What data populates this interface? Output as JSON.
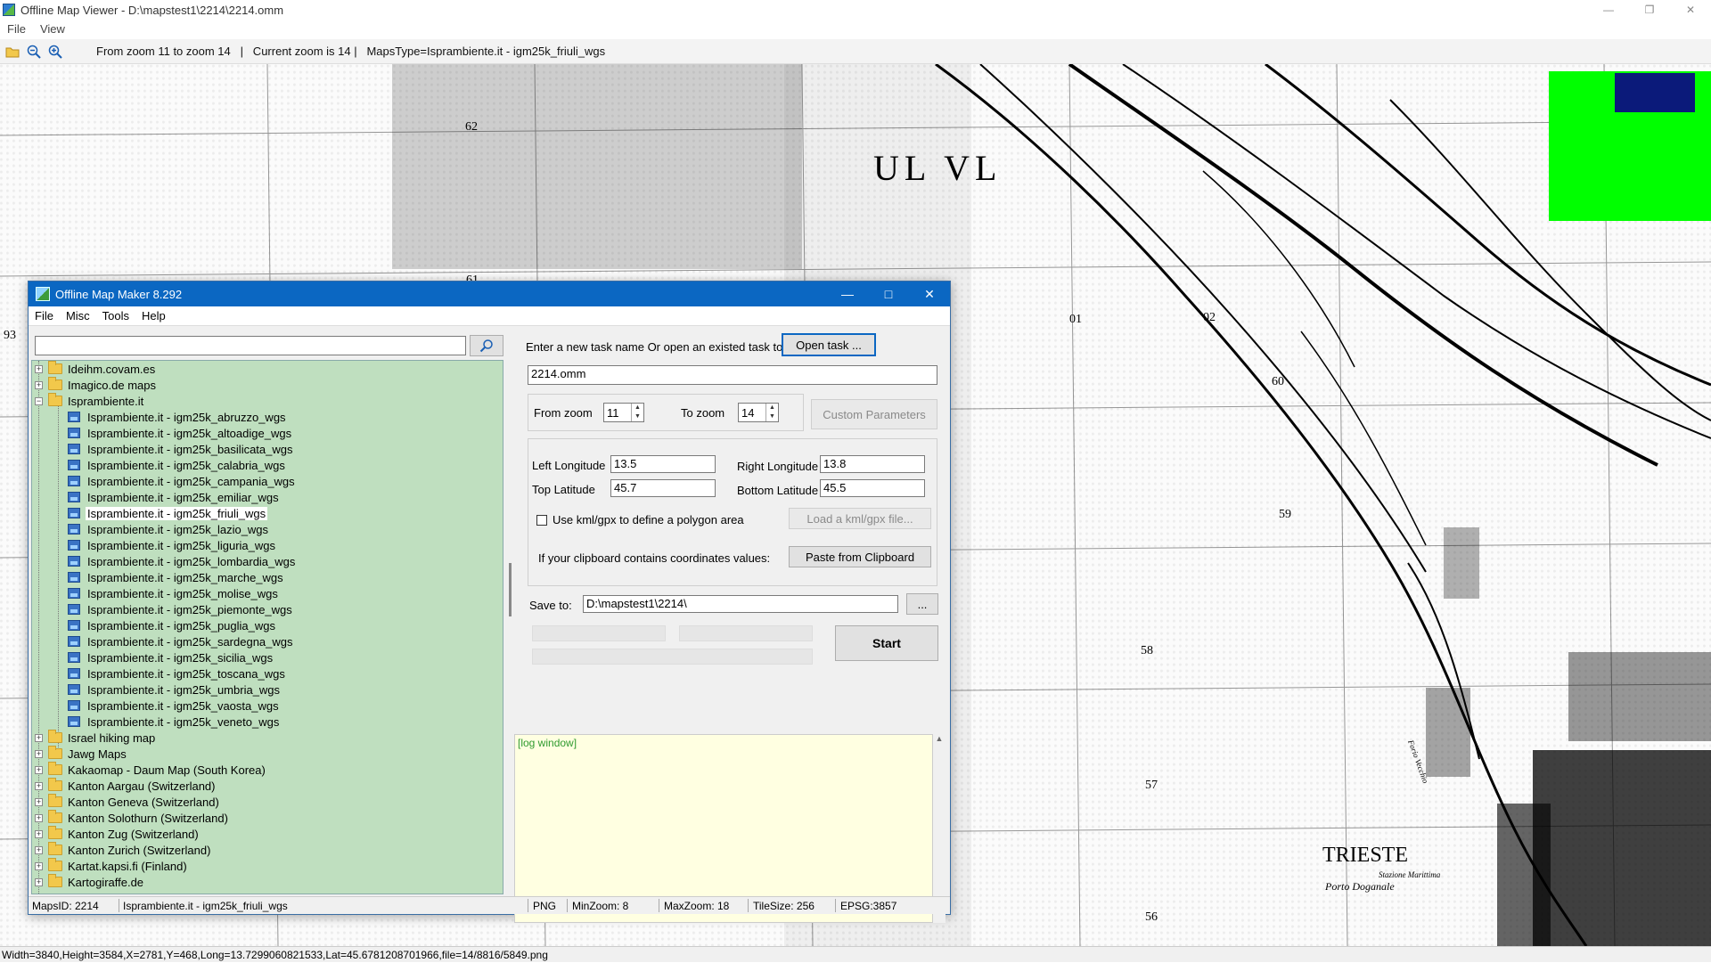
{
  "viewer": {
    "title": "Offline Map Viewer - D:\\mapstest1\\2214\\2214.omm",
    "menu": [
      "File",
      "View"
    ],
    "toolbar_text": "From zoom 11 to zoom 14   |   Current zoom is 14 |   MapsType=Isprambiente.it - igm25k_friuli_wgs",
    "status": "Width=3840,Height=3584,X=2781,Y=468,Long=13.7299060821533,Lat=45.6781208701966,file=14/8816/5849.png"
  },
  "map_labels": [
    "62",
    "UL VL",
    "61",
    "93",
    "01",
    "02",
    "60",
    "59",
    "58",
    "57",
    "56",
    "TRIESTE",
    "Porto Doganale",
    "Stazione Marittima",
    "Forio Vecchio"
  ],
  "dialog": {
    "title": "Offline Map Maker 8.292",
    "menu": [
      "File",
      "Misc",
      "Tools",
      "Help"
    ],
    "search_placeholder": "",
    "tree": {
      "top_folders": [
        "Ideihm.covam.es",
        "Imagico.de maps"
      ],
      "open_folder": "Isprambiente.it",
      "maps": [
        "Isprambiente.it - igm25k_abruzzo_wgs",
        "Isprambiente.it - igm25k_altoadige_wgs",
        "Isprambiente.it - igm25k_basilicata_wgs",
        "Isprambiente.it - igm25k_calabria_wgs",
        "Isprambiente.it - igm25k_campania_wgs",
        "Isprambiente.it - igm25k_emiliar_wgs",
        "Isprambiente.it - igm25k_friuli_wgs",
        "Isprambiente.it - igm25k_lazio_wgs",
        "Isprambiente.it - igm25k_liguria_wgs",
        "Isprambiente.it - igm25k_lombardia_wgs",
        "Isprambiente.it - igm25k_marche_wgs",
        "Isprambiente.it - igm25k_molise_wgs",
        "Isprambiente.it - igm25k_piemonte_wgs",
        "Isprambiente.it - igm25k_puglia_wgs",
        "Isprambiente.it - igm25k_sardegna_wgs",
        "Isprambiente.it - igm25k_sicilia_wgs",
        "Isprambiente.it - igm25k_toscana_wgs",
        "Isprambiente.it - igm25k_umbria_wgs",
        "Isprambiente.it - igm25k_vaosta_wgs",
        "Isprambiente.it - igm25k_veneto_wgs"
      ],
      "selected_map": "Isprambiente.it - igm25k_friuli_wgs",
      "bottom_folders": [
        "Israel hiking map",
        "Jawg Maps",
        "Kakaomap - Daum Map (South Korea)",
        "Kanton Aargau (Switzerland)",
        "Kanton Geneva (Switzerland)",
        "Kanton Solothurn (Switzerland)",
        "Kanton Zug (Switzerland)",
        "Kanton Zurich (Switzerland)",
        "Kartat.kapsi.fi (Finland)",
        "Kartogiraffe.de"
      ]
    },
    "task_prompt": "Enter a new task name Or open an existed task to continue:",
    "open_task_label": "Open task ...",
    "task_name": "2214.omm",
    "from_zoom_label": "From zoom",
    "from_zoom": "11",
    "to_zoom_label": "To zoom",
    "to_zoom": "14",
    "custom_params_label": "Custom Parameters",
    "left_lon_label": "Left Longitude",
    "left_lon": "13.5",
    "right_lon_label": "Right Longitude",
    "right_lon": "13.8",
    "top_lat_label": "Top Latitude",
    "top_lat": "45.7",
    "bottom_lat_label": "Bottom Latitude",
    "bottom_lat": "45.5",
    "kml_label": "Use kml/gpx to define a polygon area",
    "load_kml_label": "Load a kml/gpx file...",
    "clipboard_label": "If your clipboard contains coordinates values:",
    "paste_label": "Paste from Clipboard",
    "save_to_label": "Save to:",
    "save_to": "D:\\mapstest1\\2214\\",
    "browse_label": "...",
    "start_label": "Start",
    "log_text": "[log window]",
    "status": {
      "maps_id": "MapsID: 2214",
      "map_name": "Isprambiente.it - igm25k_friuli_wgs",
      "format": "PNG",
      "min_zoom": "MinZoom: 8",
      "max_zoom": "MaxZoom: 18",
      "tile_size": "TileSize: 256",
      "epsg": "EPSG:3857"
    }
  },
  "colors": {
    "dialog_title_bg": "#0b67c2",
    "tree_bg": "#bfdfbf",
    "log_bg": "#ffffe1",
    "overview_bg": "#00ff00",
    "overview_frame": "#0b1a7a"
  }
}
